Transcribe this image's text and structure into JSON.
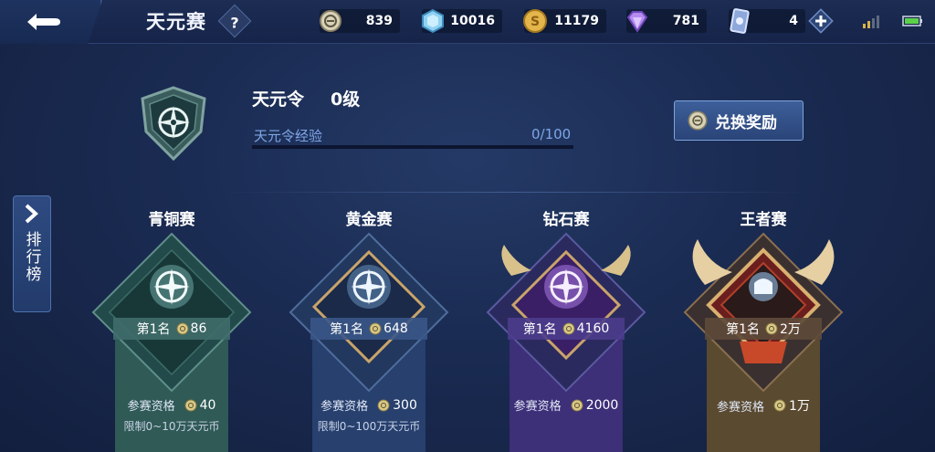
{
  "header": {
    "title": "天元赛",
    "help": "?",
    "currencies": [
      {
        "icon": "tianyuan-coin-icon",
        "value": "839"
      },
      {
        "icon": "crystal-icon",
        "value": "10016"
      },
      {
        "icon": "gold-coin-icon",
        "value": "11179"
      },
      {
        "icon": "diamond-icon",
        "value": "781"
      },
      {
        "icon": "ticket-card-icon",
        "value": "4"
      }
    ]
  },
  "pass": {
    "title": "天元令",
    "level": "0级",
    "exp_label": "天元令经验",
    "exp_value": "0/100",
    "exp_progress": 0,
    "redeem_label": "兑换奖励"
  },
  "sidebar": {
    "ranking_label": "排行榜"
  },
  "tiers": [
    {
      "name": "青铜赛",
      "rank": "第1名",
      "reward": "86",
      "entry_label": "参赛资格",
      "entry_cost": "40",
      "limit": "限制0~10万天元币",
      "color": "#2f5a55"
    },
    {
      "name": "黄金赛",
      "rank": "第1名",
      "reward": "648",
      "entry_label": "参赛资格",
      "entry_cost": "300",
      "limit": "限制0~100万天元币",
      "color": "#27406e"
    },
    {
      "name": "钻石赛",
      "rank": "第1名",
      "reward": "4160",
      "entry_label": "参赛资格",
      "entry_cost": "2000",
      "limit": "",
      "color": "#3d2f78"
    },
    {
      "name": "王者赛",
      "rank": "第1名",
      "reward": "2万",
      "entry_label": "参赛资格",
      "entry_cost": "1万",
      "limit": "",
      "color": "#5a4a30"
    }
  ],
  "colors": {
    "accent": "#6aa0ff",
    "exp_text": "#7fa6e6",
    "bronze": "#2f5a55",
    "gold": "#27406e",
    "diamond": "#3d2f78",
    "king": "#5a4a30"
  }
}
